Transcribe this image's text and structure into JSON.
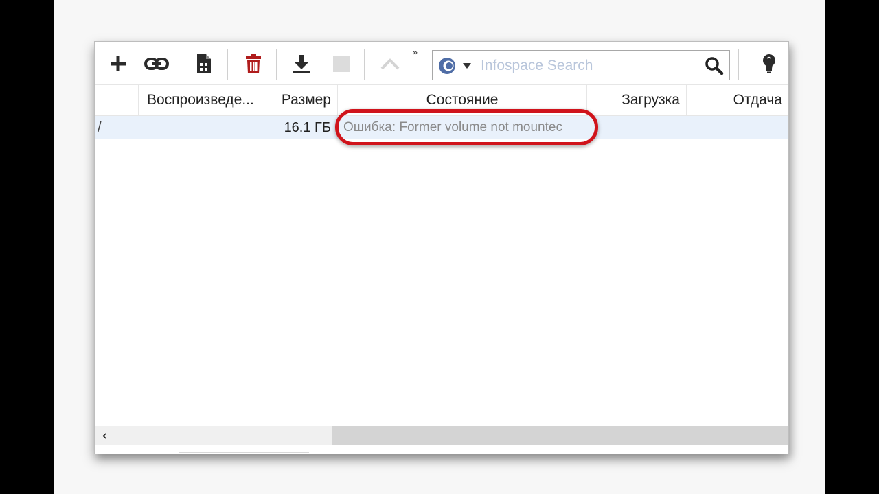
{
  "toolbar": {
    "buttons": [
      {
        "name": "add-torrent-button",
        "icon": "plus-icon"
      },
      {
        "name": "add-link-button",
        "icon": "link-icon"
      },
      {
        "name": "create-torrent-button",
        "icon": "file-icon"
      },
      {
        "name": "remove-button",
        "icon": "trash-icon"
      },
      {
        "name": "start-button",
        "icon": "download-icon"
      },
      {
        "name": "stop-button",
        "icon": "stop-icon"
      },
      {
        "name": "move-up-button",
        "icon": "chevron-up-icon"
      }
    ],
    "overflow_label": "»",
    "search": {
      "engine_icon": "infospace-icon",
      "placeholder": "Infospace Search",
      "value": ""
    },
    "tip_icon": "lightbulb-icon"
  },
  "table": {
    "columns": [
      "Воспроизведе...",
      "Размер",
      "Состояние",
      "Загрузка",
      "Отдача"
    ],
    "rows": [
      {
        "name_fragment": "/",
        "playback": "",
        "size": "16.1 ГБ",
        "status": "Ошибка: Former volume not mountec",
        "download": "",
        "upload": ""
      }
    ]
  },
  "scrollbar": {
    "left_arrow": "‹"
  },
  "colors": {
    "highlight": "#d0131b",
    "delete_icon": "#b01c1c",
    "selected_row": "#e9f1fb",
    "status_text": "#8a8a8a",
    "search_placeholder": "#b9c6db"
  }
}
